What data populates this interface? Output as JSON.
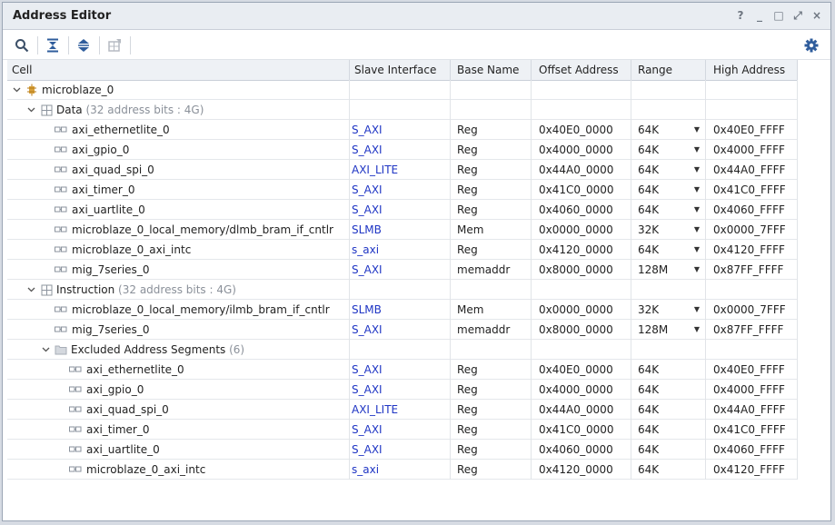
{
  "window": {
    "title": "Address Editor"
  },
  "window_controls": [
    "?",
    "_",
    "□",
    "⤢",
    "×"
  ],
  "toolbar": {
    "icons": [
      "search-icon",
      "collapse-all-icon",
      "expand-all-icon",
      "auto-assign-icon",
      "settings-icon"
    ]
  },
  "columns": [
    "Cell",
    "Slave Interface",
    "Base Name",
    "Offset Address",
    "Range",
    "High Address"
  ],
  "tree": {
    "root": "microblaze_0",
    "data_label": "Data",
    "data_suffix": "(32 address bits : 4G)",
    "instruction_label": "Instruction",
    "instruction_suffix": "(32 address bits : 4G)",
    "excluded_label": "Excluded Address Segments",
    "excluded_suffix": "(6)"
  },
  "data_rows": [
    {
      "cell": "axi_ethernetlite_0",
      "iface": "S_AXI",
      "base": "Reg",
      "offset": "0x40E0_0000",
      "range": "64K",
      "high": "0x40E0_FFFF"
    },
    {
      "cell": "axi_gpio_0",
      "iface": "S_AXI",
      "base": "Reg",
      "offset": "0x4000_0000",
      "range": "64K",
      "high": "0x4000_FFFF"
    },
    {
      "cell": "axi_quad_spi_0",
      "iface": "AXI_LITE",
      "base": "Reg",
      "offset": "0x44A0_0000",
      "range": "64K",
      "high": "0x44A0_FFFF"
    },
    {
      "cell": "axi_timer_0",
      "iface": "S_AXI",
      "base": "Reg",
      "offset": "0x41C0_0000",
      "range": "64K",
      "high": "0x41C0_FFFF"
    },
    {
      "cell": "axi_uartlite_0",
      "iface": "S_AXI",
      "base": "Reg",
      "offset": "0x4060_0000",
      "range": "64K",
      "high": "0x4060_FFFF"
    },
    {
      "cell": "microblaze_0_local_memory/dlmb_bram_if_cntlr",
      "iface": "SLMB",
      "base": "Mem",
      "offset": "0x0000_0000",
      "range": "32K",
      "high": "0x0000_7FFF"
    },
    {
      "cell": "microblaze_0_axi_intc",
      "iface": "s_axi",
      "base": "Reg",
      "offset": "0x4120_0000",
      "range": "64K",
      "high": "0x4120_FFFF"
    },
    {
      "cell": "mig_7series_0",
      "iface": "S_AXI",
      "base": "memaddr",
      "offset": "0x8000_0000",
      "range": "128M",
      "high": "0x87FF_FFFF"
    }
  ],
  "instruction_rows": [
    {
      "cell": "microblaze_0_local_memory/ilmb_bram_if_cntlr",
      "iface": "SLMB",
      "base": "Mem",
      "offset": "0x0000_0000",
      "range": "32K",
      "high": "0x0000_7FFF"
    },
    {
      "cell": "mig_7series_0",
      "iface": "S_AXI",
      "base": "memaddr",
      "offset": "0x8000_0000",
      "range": "128M",
      "high": "0x87FF_FFFF"
    }
  ],
  "excluded_rows": [
    {
      "cell": "axi_ethernetlite_0",
      "iface": "S_AXI",
      "base": "Reg",
      "offset": "0x40E0_0000",
      "range": "64K",
      "high": "0x40E0_FFFF"
    },
    {
      "cell": "axi_gpio_0",
      "iface": "S_AXI",
      "base": "Reg",
      "offset": "0x4000_0000",
      "range": "64K",
      "high": "0x4000_FFFF"
    },
    {
      "cell": "axi_quad_spi_0",
      "iface": "AXI_LITE",
      "base": "Reg",
      "offset": "0x44A0_0000",
      "range": "64K",
      "high": "0x44A0_FFFF"
    },
    {
      "cell": "axi_timer_0",
      "iface": "S_AXI",
      "base": "Reg",
      "offset": "0x41C0_0000",
      "range": "64K",
      "high": "0x41C0_FFFF"
    },
    {
      "cell": "axi_uartlite_0",
      "iface": "S_AXI",
      "base": "Reg",
      "offset": "0x4060_0000",
      "range": "64K",
      "high": "0x4060_FFFF"
    },
    {
      "cell": "microblaze_0_axi_intc",
      "iface": "s_axi",
      "base": "Reg",
      "offset": "0x4120_0000",
      "range": "64K",
      "high": "0x4120_FFFF"
    }
  ],
  "colors": {
    "link": "#1f35c4",
    "muted": "#8a9099",
    "header_bg": "#eef1f5"
  }
}
